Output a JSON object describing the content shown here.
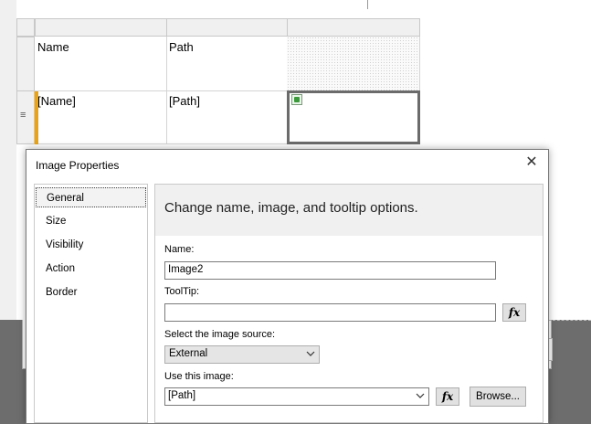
{
  "tablix": {
    "header_row": {
      "col1": "Name",
      "col2": "Path"
    },
    "data_row": {
      "col1": "[Name]",
      "col2": "[Path]"
    },
    "row_handle_glyph": "≡"
  },
  "dialog": {
    "title": "Image Properties",
    "close_glyph": "✕",
    "nav_items": [
      "General",
      "Size",
      "Visibility",
      "Action",
      "Border"
    ],
    "heading": "Change name, image, and tooltip options.",
    "name_label": "Name:",
    "name_value": "Image2",
    "tooltip_label": "ToolTip:",
    "tooltip_value": "",
    "fx_glyph": "fx",
    "source_label": "Select the image source:",
    "source_value": "External",
    "use_image_label": "Use this image:",
    "use_image_value": "[Path]",
    "browse_label": "Browse..."
  }
}
